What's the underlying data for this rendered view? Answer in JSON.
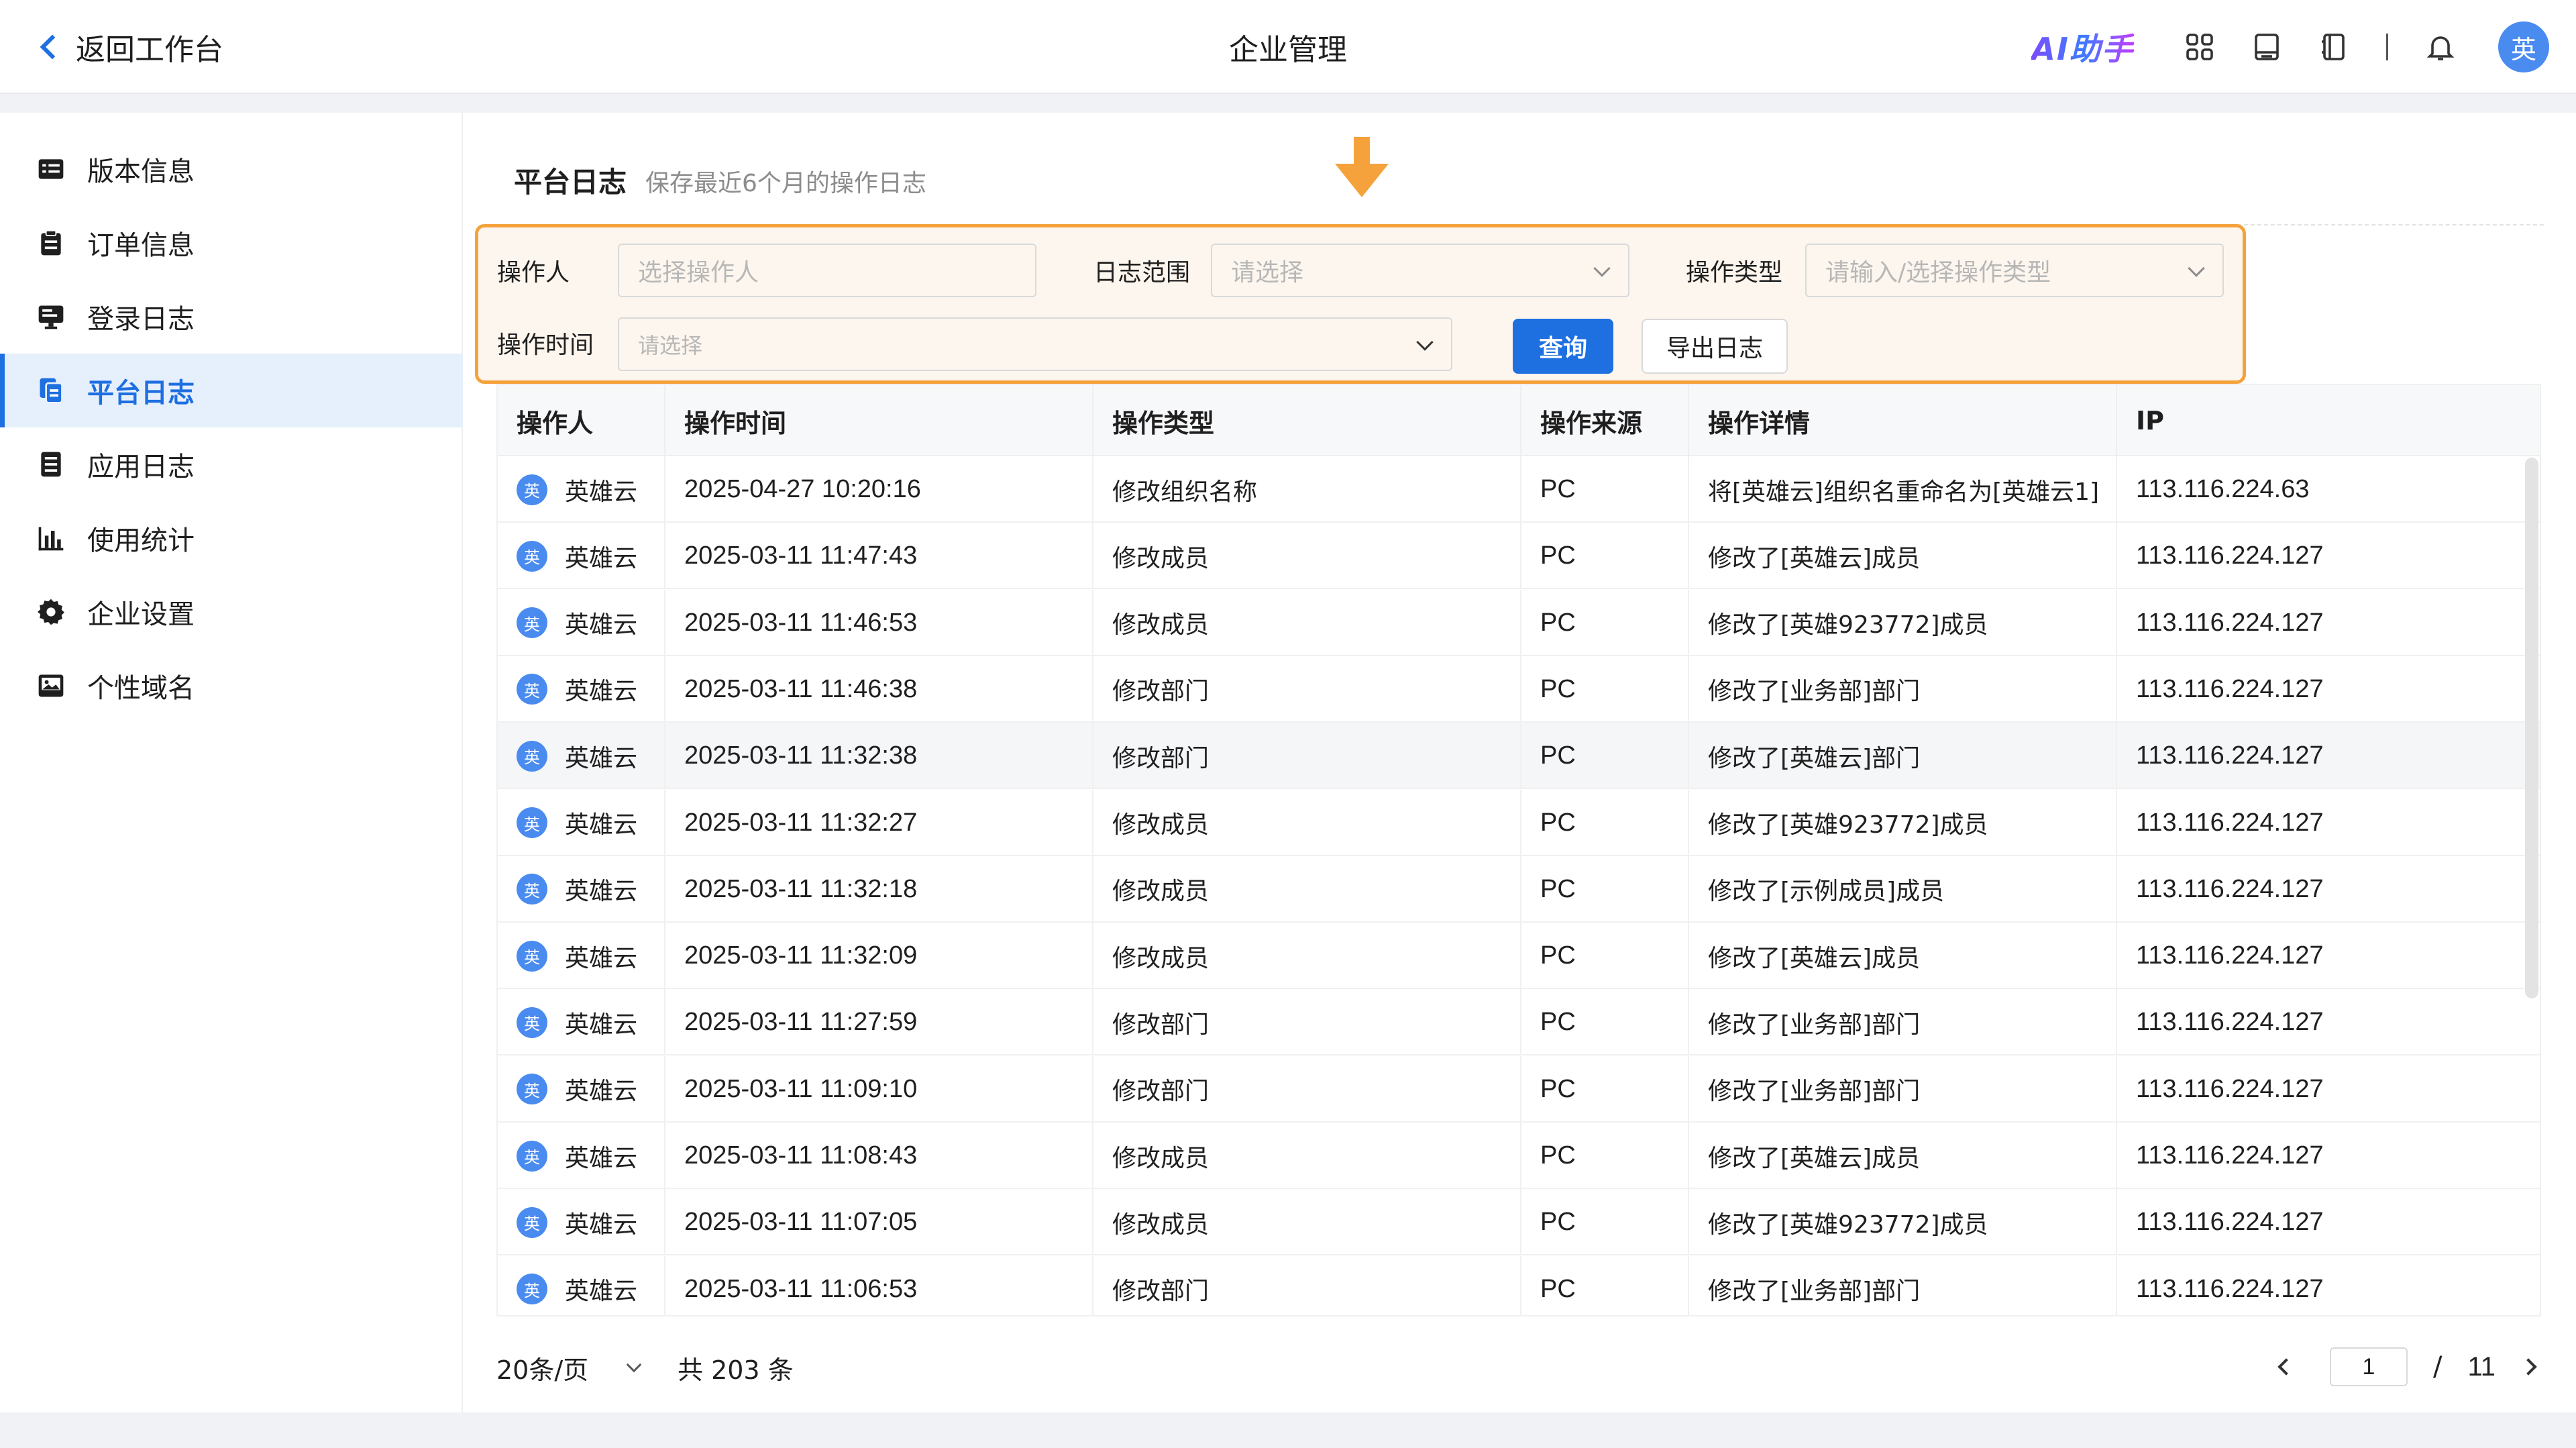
{
  "header": {
    "back_label": "返回工作台",
    "title": "企业管理",
    "ai_label": "AI助手",
    "avatar_text": "英",
    "icons": [
      "apps-icon",
      "book-icon",
      "notebook-icon",
      "bell-icon"
    ]
  },
  "sidebar": {
    "items": [
      {
        "label": "版本信息",
        "icon": "version-card-icon",
        "active": false
      },
      {
        "label": "订单信息",
        "icon": "clipboard-icon",
        "active": false
      },
      {
        "label": "登录日志",
        "icon": "monitor-icon",
        "active": false
      },
      {
        "label": "平台日志",
        "icon": "copy-doc-icon",
        "active": true
      },
      {
        "label": "应用日志",
        "icon": "list-doc-icon",
        "active": false
      },
      {
        "label": "使用统计",
        "icon": "bar-chart-icon",
        "active": false
      },
      {
        "label": "企业设置",
        "icon": "gear-icon",
        "active": false
      },
      {
        "label": "个性域名",
        "icon": "image-icon",
        "active": false
      }
    ]
  },
  "page": {
    "title": "平台日志",
    "subtitle": "保存最近6个月的操作日志"
  },
  "filter": {
    "operator_label": "操作人",
    "operator_placeholder": "选择操作人",
    "scope_label": "日志范围",
    "scope_placeholder": "请选择",
    "type_label": "操作类型",
    "type_placeholder": "请输入/选择操作类型",
    "time_label": "操作时间",
    "time_placeholder": "请选择",
    "query_button": "查询",
    "export_button": "导出日志"
  },
  "table": {
    "columns": [
      "操作人",
      "操作时间",
      "操作类型",
      "操作来源",
      "操作详情",
      "IP"
    ],
    "avatar_text": "英",
    "rows": [
      {
        "operator": "英雄云",
        "time": "2025-04-27 10:20:16",
        "type": "修改组织名称",
        "source": "PC",
        "detail": "将[英雄云]组织名重命名为[英雄云1]",
        "ip": "113.116.224.63"
      },
      {
        "operator": "英雄云",
        "time": "2025-03-11 11:47:43",
        "type": "修改成员",
        "source": "PC",
        "detail": "修改了[英雄云]成员",
        "ip": "113.116.224.127"
      },
      {
        "operator": "英雄云",
        "time": "2025-03-11 11:46:53",
        "type": "修改成员",
        "source": "PC",
        "detail": "修改了[英雄923772]成员",
        "ip": "113.116.224.127"
      },
      {
        "operator": "英雄云",
        "time": "2025-03-11 11:46:38",
        "type": "修改部门",
        "source": "PC",
        "detail": "修改了[业务部]部门",
        "ip": "113.116.224.127"
      },
      {
        "operator": "英雄云",
        "time": "2025-03-11 11:32:38",
        "type": "修改部门",
        "source": "PC",
        "detail": "修改了[英雄云]部门",
        "ip": "113.116.224.127"
      },
      {
        "operator": "英雄云",
        "time": "2025-03-11 11:32:27",
        "type": "修改成员",
        "source": "PC",
        "detail": "修改了[英雄923772]成员",
        "ip": "113.116.224.127"
      },
      {
        "operator": "英雄云",
        "time": "2025-03-11 11:32:18",
        "type": "修改成员",
        "source": "PC",
        "detail": "修改了[示例成员]成员",
        "ip": "113.116.224.127"
      },
      {
        "operator": "英雄云",
        "time": "2025-03-11 11:32:09",
        "type": "修改成员",
        "source": "PC",
        "detail": "修改了[英雄云]成员",
        "ip": "113.116.224.127"
      },
      {
        "operator": "英雄云",
        "time": "2025-03-11 11:27:59",
        "type": "修改部门",
        "source": "PC",
        "detail": "修改了[业务部]部门",
        "ip": "113.116.224.127"
      },
      {
        "operator": "英雄云",
        "time": "2025-03-11 11:09:10",
        "type": "修改部门",
        "source": "PC",
        "detail": "修改了[业务部]部门",
        "ip": "113.116.224.127"
      },
      {
        "operator": "英雄云",
        "time": "2025-03-11 11:08:43",
        "type": "修改成员",
        "source": "PC",
        "detail": "修改了[英雄云]成员",
        "ip": "113.116.224.127"
      },
      {
        "operator": "英雄云",
        "time": "2025-03-11 11:07:05",
        "type": "修改成员",
        "source": "PC",
        "detail": "修改了[英雄923772]成员",
        "ip": "113.116.224.127"
      },
      {
        "operator": "英雄云",
        "time": "2025-03-11 11:06:53",
        "type": "修改部门",
        "source": "PC",
        "detail": "修改了[业务部]部门",
        "ip": "113.116.224.127"
      }
    ]
  },
  "pagination": {
    "page_size": "20条/页",
    "total": "共 203 条",
    "current_page": "1",
    "separator": "/",
    "total_pages": "11"
  },
  "colors": {
    "primary": "#1e6fe0",
    "highlight_border": "#f5a23c",
    "highlight_arrow": "#f5a23c",
    "avatar": "#4a8bf0"
  }
}
